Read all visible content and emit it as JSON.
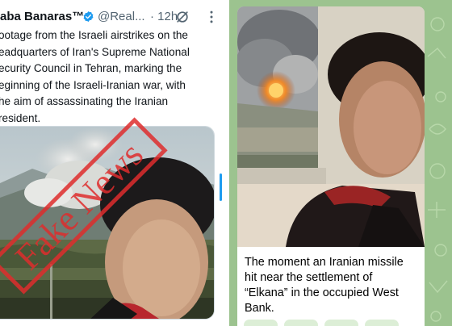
{
  "tweet": {
    "author_name": "aba Banaras™",
    "handle": "@Real...",
    "separator": "·",
    "time": "12h",
    "text_lines": [
      "ootage from the Israeli airstrikes on the",
      "eadquarters of Iran's Supreme National",
      "ecurity Council in Tehran, marking the",
      "eginning of the Israeli-Iranian war, with",
      "he aim of assassinating the Iranian",
      "resident."
    ],
    "stamp_text": "Fake News",
    "colors": {
      "verified": "#1d9bf0",
      "stamp": "#de2d2d",
      "scroll_handle": "#1d9bf0"
    },
    "icons": {
      "verified": "verified-badge-icon",
      "grok": "grok-icon",
      "more": "more-options-icon"
    }
  },
  "telegram": {
    "caption_lines": [
      "The moment an Iranian missile",
      "hit near the settlement of",
      "“Elkana” in the occupied West",
      "Bank."
    ],
    "background_color": "#9cc38f"
  }
}
